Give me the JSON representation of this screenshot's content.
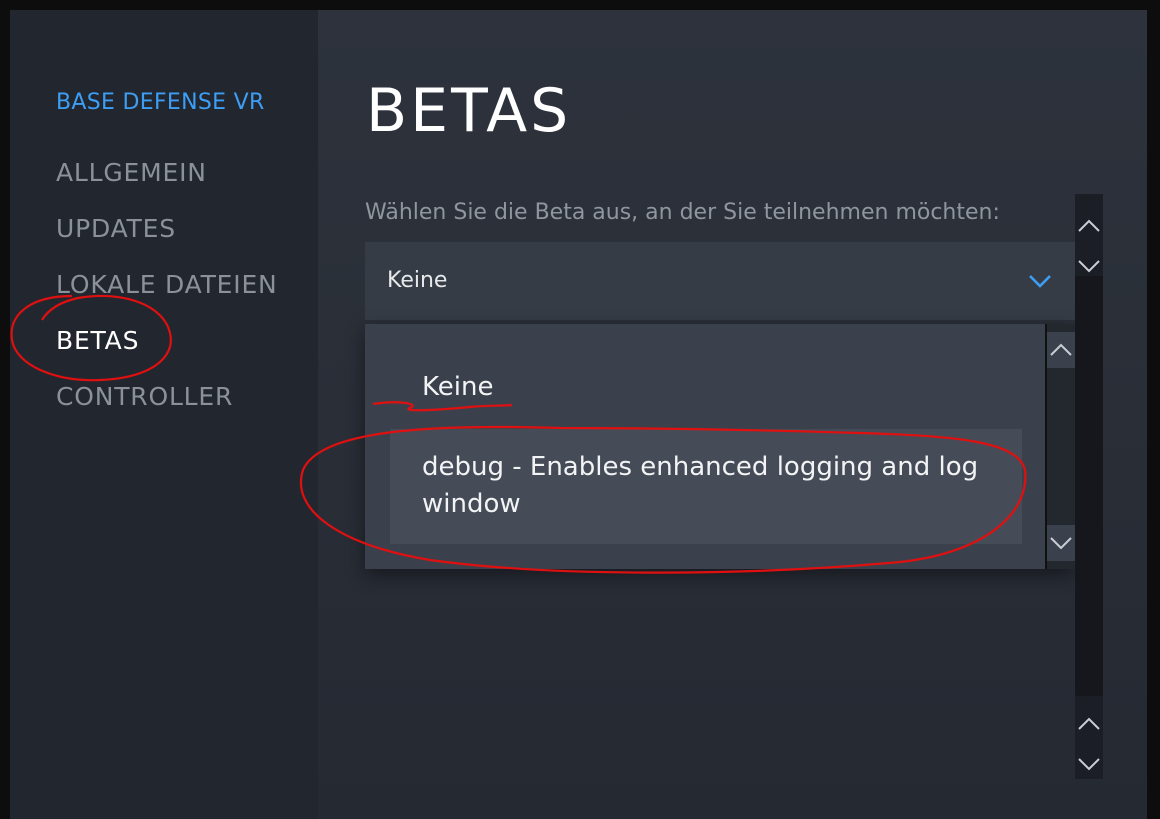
{
  "sidebar": {
    "game_title": "BASE DEFENSE VR",
    "items": [
      {
        "label": "ALLGEMEIN"
      },
      {
        "label": "UPDATES"
      },
      {
        "label": "LOKALE DATEIEN"
      },
      {
        "label": "BETAS"
      },
      {
        "label": "CONTROLLER"
      }
    ],
    "active_item": "BETAS"
  },
  "main": {
    "title": "BETAS",
    "prompt": "Wählen Sie die Beta aus, an der Sie teilnehmen möchten:",
    "select": {
      "value": "Keine",
      "options": [
        {
          "label": "Keine"
        },
        {
          "label": "debug - Enables enhanced logging and log window"
        }
      ],
      "highlighted_option": "debug - Enables enhanced logging and log window"
    }
  },
  "colors": {
    "accent": "#3d9ef5",
    "annotation": "#e01010"
  },
  "icons": [
    "chevron-down-icon",
    "chevron-up-icon"
  ]
}
